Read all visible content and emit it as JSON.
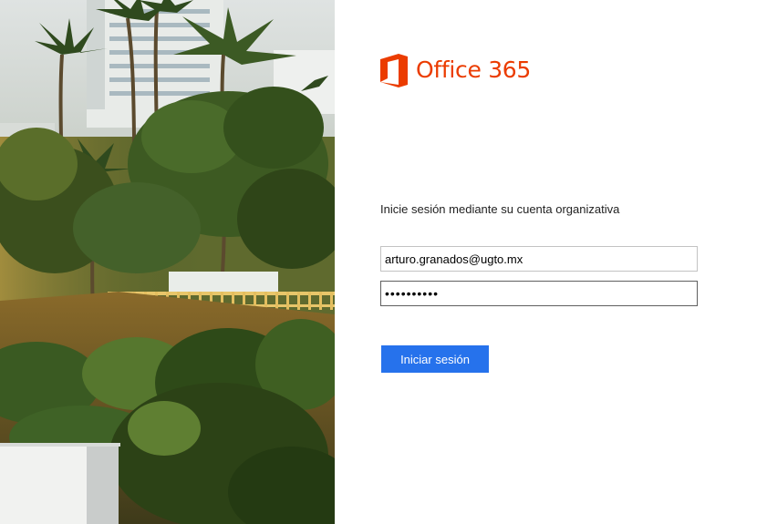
{
  "brand": {
    "name": "Office 365",
    "color": "#eb3c00",
    "logo_icon": "office-logo-icon"
  },
  "login": {
    "prompt": "Inicie sesión mediante su cuenta organizativa",
    "username_value": "arturo.granados@ugto.mx",
    "password_value": "••••••••••",
    "signin_label": "Iniciar sesión",
    "button_color": "#2672ec"
  }
}
